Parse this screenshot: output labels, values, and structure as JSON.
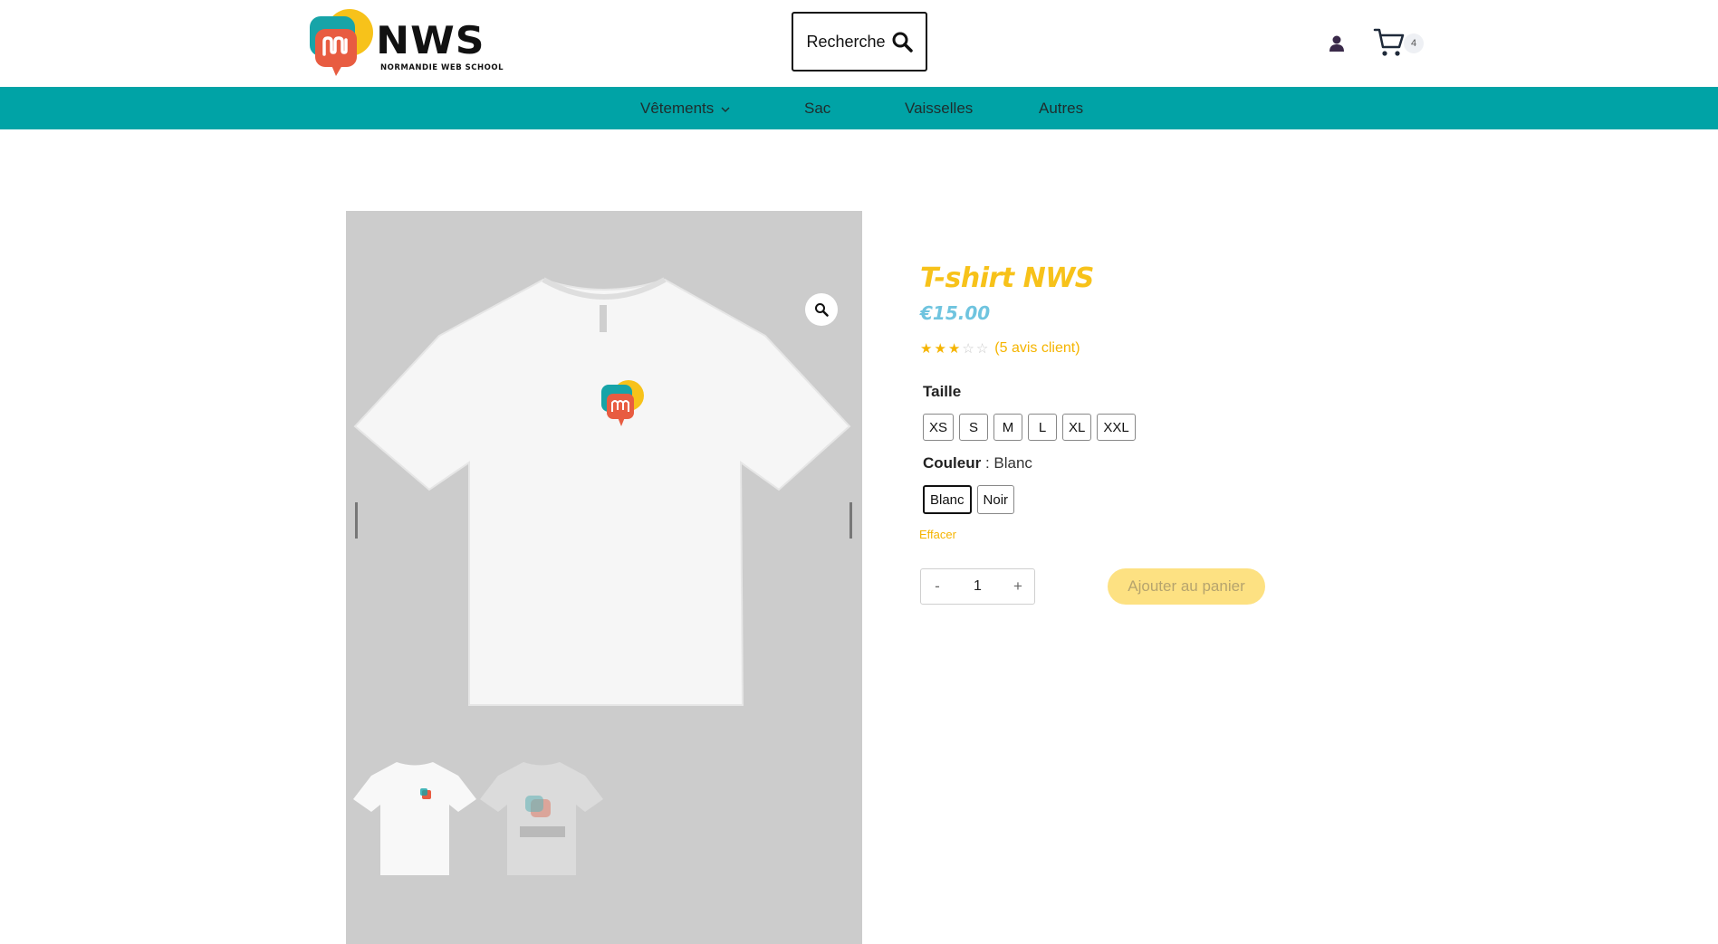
{
  "header": {
    "logo_text": "NWS",
    "logo_subtitle": "NORMANDIE WEB SCHOOL",
    "search_label": "Recherche",
    "cart_count": "4"
  },
  "nav": {
    "items": [
      {
        "label": "Vêtements"
      },
      {
        "label": "Sac"
      },
      {
        "label": "Vaisselles"
      },
      {
        "label": "Autres"
      }
    ]
  },
  "product": {
    "title": "T-shirt NWS",
    "price": "€15.00",
    "rating": 3,
    "rating_max": 5,
    "reviews_link": "(5 avis client)",
    "size_label": "Taille",
    "sizes": [
      "XS",
      "S",
      "M",
      "L",
      "XL",
      "XXL"
    ],
    "color_label": "Couleur",
    "color_selected": "Blanc",
    "colors": [
      "Blanc",
      "Noir"
    ],
    "clear_label": "Effacer",
    "quantity": "1",
    "qty_minus": "-",
    "qty_plus": "+",
    "add_to_cart": "Ajouter au panier"
  },
  "colors": {
    "nav_bg": "#00a3a6",
    "title": "#f7c21a",
    "price": "#6fc4df",
    "star": "#f5b400",
    "add_to_cart_bg": "#fde182"
  },
  "icons": [
    "nws-logo-icon",
    "search-icon",
    "user-icon",
    "cart-icon",
    "chevron-down-icon",
    "zoom-icon",
    "star-icon"
  ]
}
